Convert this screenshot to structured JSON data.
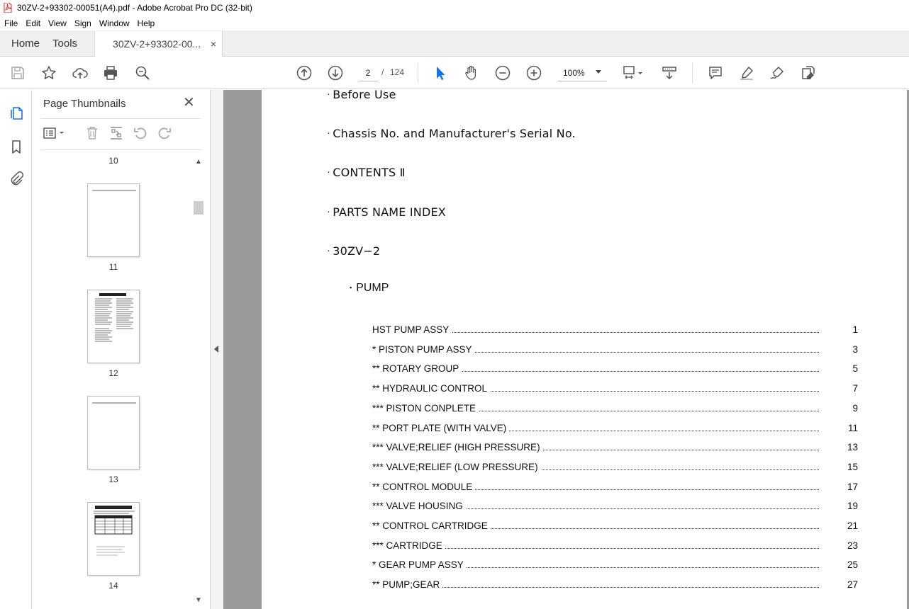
{
  "window": {
    "title": "30ZV-2+93302-00051(A4).pdf - Adobe Acrobat Pro DC (32-bit)"
  },
  "menu": [
    "File",
    "Edit",
    "View",
    "Sign",
    "Window",
    "Help"
  ],
  "tabs": {
    "home": "Home",
    "tools": "Tools",
    "document": "30ZV-2+93302-00...",
    "close": "×"
  },
  "toolbar": {
    "page_current": "2",
    "page_separator": "/",
    "page_total": "124",
    "zoom": "100%"
  },
  "thumbnails": {
    "title": "Page Thumbnails",
    "close": "✕",
    "pages": [
      "10",
      "11",
      "12",
      "13",
      "14"
    ]
  },
  "document": {
    "headings": [
      "Before Use",
      "Chassis No. and Manufacturer's Serial No.",
      "CONTENTS Ⅱ",
      "PARTS NAME INDEX",
      "30ZV−2"
    ],
    "bullet": "･",
    "section": "PUMP",
    "section_bullet": "▪",
    "toc": [
      {
        "name": "HST PUMP ASSY",
        "page": "1"
      },
      {
        "name": "* PISTON PUMP ASSY",
        "page": "3"
      },
      {
        "name": "** ROTARY GROUP",
        "page": "5"
      },
      {
        "name": "** HYDRAULIC CONTROL",
        "page": "7"
      },
      {
        "name": "*** PISTON CONPLETE",
        "page": "9"
      },
      {
        "name": "** PORT PLATE (WITH VALVE)",
        "page": "11"
      },
      {
        "name": "*** VALVE;RELIEF (HIGH PRESSURE)",
        "page": "13"
      },
      {
        "name": "*** VALVE;RELIEF (LOW PRESSURE)",
        "page": "15"
      },
      {
        "name": "** CONTROL MODULE",
        "page": "17"
      },
      {
        "name": "*** VALVE HOUSING",
        "page": "19"
      },
      {
        "name": "** CONTROL CARTRIDGE",
        "page": "21"
      },
      {
        "name": "*** CARTRIDGE",
        "page": "23"
      },
      {
        "name": "* GEAR PUMP ASSY",
        "page": "25"
      },
      {
        "name": "** PUMP;GEAR",
        "page": "27"
      }
    ]
  },
  "colors": {
    "accent_blue": "#1473e6",
    "acrobat_red": "#d9261c",
    "canvas_gray": "#9a9a9a"
  }
}
